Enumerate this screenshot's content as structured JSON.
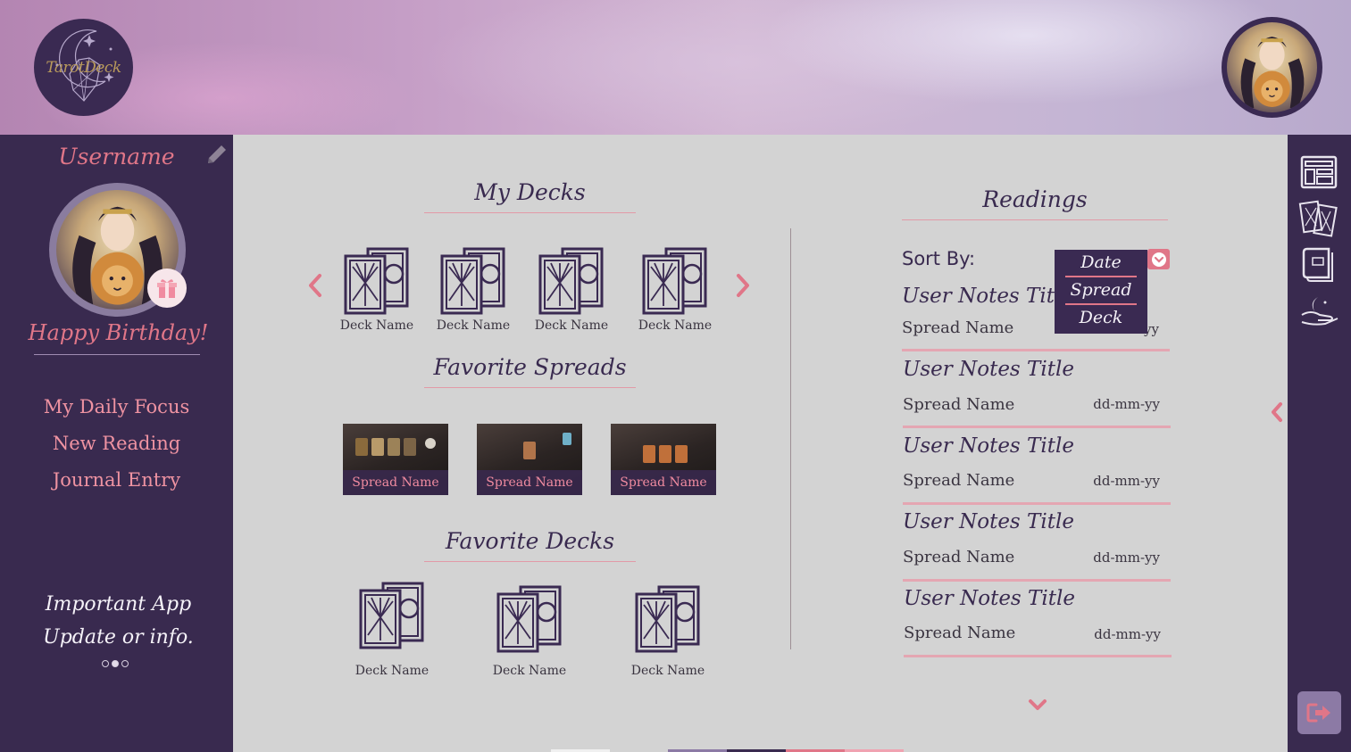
{
  "app": {
    "logo_text": "TarotDeck"
  },
  "sidebar": {
    "username": "Username",
    "birthday": "Happy Birthday!",
    "nav": [
      {
        "label": "My Daily Focus"
      },
      {
        "label": "New Reading"
      },
      {
        "label": "Journal Entry"
      }
    ],
    "info": {
      "line1": "Important App",
      "line2": "Update or info."
    }
  },
  "main": {
    "my_decks": {
      "title": "My Decks",
      "items": [
        {
          "label": "Deck Name"
        },
        {
          "label": "Deck Name"
        },
        {
          "label": "Deck Name"
        },
        {
          "label": "Deck Name"
        }
      ]
    },
    "favorite_spreads": {
      "title": "Favorite Spreads",
      "items": [
        {
          "label": "Spread Name"
        },
        {
          "label": "Spread Name"
        },
        {
          "label": "Spread Name"
        }
      ]
    },
    "favorite_decks": {
      "title": "Favorite Decks",
      "items": [
        {
          "label": "Deck Name"
        },
        {
          "label": "Deck Name"
        },
        {
          "label": "Deck Name"
        }
      ]
    }
  },
  "readings": {
    "title": "Readings",
    "sort_label": "Sort By:",
    "sort_options": [
      "Date",
      "Spread",
      "Deck"
    ],
    "items": [
      {
        "title": "User Notes Title",
        "spread": "Spread Name",
        "date": "dd-mm-yy"
      },
      {
        "title": "User Notes Title",
        "spread": "Spread Name",
        "date": "dd-mm-yy"
      },
      {
        "title": "User Notes Title",
        "spread": "Spread Name",
        "date": "dd-mm-yy"
      },
      {
        "title": "User Notes Title",
        "spread": "Spread Name",
        "date": "dd-mm-yy"
      },
      {
        "title": "User Notes Title",
        "spread": "Spread Name",
        "date": "dd-mm-yy"
      }
    ]
  },
  "right_bar": {
    "icons": [
      "layout-icon",
      "cards-icon",
      "book-icon",
      "hand-icon"
    ]
  },
  "colors": {
    "sidebar": "#392a4f",
    "accent": "#e07688",
    "background": "#d3d3d3"
  }
}
